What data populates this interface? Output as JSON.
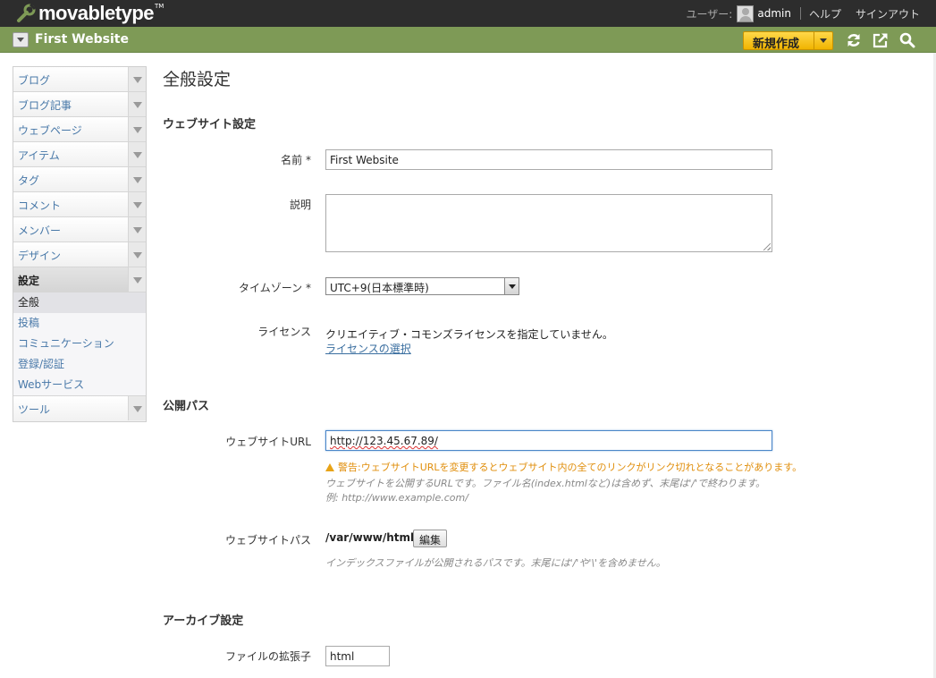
{
  "header": {
    "logo_text": "movabletype",
    "logo_tm": "TM",
    "user_label": "ユーザー:",
    "username": "admin",
    "help": "ヘルプ",
    "signout": "サインアウト"
  },
  "sitebar": {
    "site_name": "First Website",
    "new_button": "新規作成",
    "bg_color": "#7e9a56",
    "accent_color": "#f0b400"
  },
  "sidebar": {
    "items": [
      {
        "label": "ブログ"
      },
      {
        "label": "ブログ記事"
      },
      {
        "label": "ウェブページ"
      },
      {
        "label": "アイテム"
      },
      {
        "label": "タグ"
      },
      {
        "label": "コメント"
      },
      {
        "label": "メンバー"
      },
      {
        "label": "デザイン"
      },
      {
        "label": "設定"
      },
      {
        "label": "ツール"
      }
    ],
    "settings_sub": [
      {
        "label": "全般"
      },
      {
        "label": "投稿"
      },
      {
        "label": "コミュニケーション"
      },
      {
        "label": "登録/認証"
      },
      {
        "label": "Webサービス"
      }
    ]
  },
  "main": {
    "title": "全般設定",
    "website_section": "ウェブサイト設定",
    "name_label": "名前 *",
    "name_value": "First Website",
    "description_label": "説明",
    "description_value": "",
    "timezone_label": "タイムゾーン *",
    "timezone_value": "UTC+9(日本標準時)",
    "license_label": "ライセンス",
    "license_text": "クリエイティブ・コモンズライセンスを指定していません。",
    "license_link": "ライセンスの選択",
    "publish_section": "公開パス",
    "url_label": "ウェブサイトURL",
    "url_value": "http://123.45.67.89/",
    "url_warning": "警告:ウェブサイトURLを変更するとウェブサイト内の全てのリンクがリンク切れとなることがあります。",
    "url_hint_1": "ウェブサイトを公開するURLです。ファイル名(index.htmlなど)は含めず、末尾は'/'で終わります。",
    "url_hint_2": "例: http://www.example.com/",
    "path_label": "ウェブサイトパス",
    "path_value": "/var/www/html",
    "path_edit_button": "編集",
    "path_hint": "インデックスファイルが公開されるパスです。末尾には'/'や'\\'を含めません。",
    "archive_section": "アーカイブ設定",
    "ext_label": "ファイルの拡張子",
    "ext_value": "html"
  }
}
